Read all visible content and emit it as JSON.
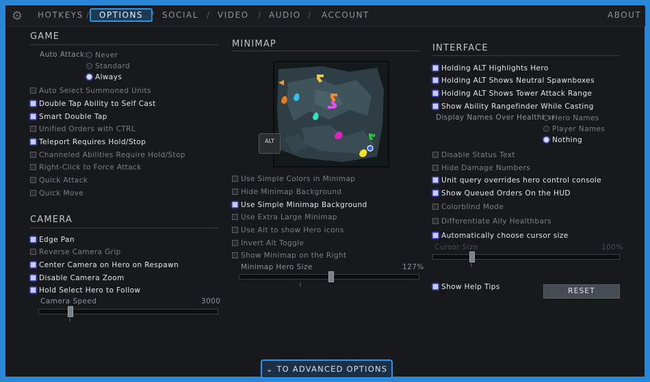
{
  "nav": {
    "tabs": [
      "HOTKEYS",
      "OPTIONS",
      "SOCIAL",
      "VIDEO",
      "AUDIO",
      "ACCOUNT"
    ],
    "active_tab": "OPTIONS",
    "about": "ABOUT",
    "separator": "/"
  },
  "game": {
    "title": "GAME",
    "auto_attack_label": "Auto Attack:",
    "auto_attack_options": [
      "Never",
      "Standard",
      "Always"
    ],
    "auto_attack_selected": "Always",
    "options": [
      {
        "label": "Auto Select Summoned Units",
        "checked": false
      },
      {
        "label": "Double Tap Ability to Self Cast",
        "checked": true
      },
      {
        "label": "Smart Double Tap",
        "checked": true
      },
      {
        "label": "Unified Orders with CTRL",
        "checked": false
      },
      {
        "label": "Teleport Requires Hold/Stop",
        "checked": true
      },
      {
        "label": "Channeled Abilities Require Hold/Stop",
        "checked": false
      },
      {
        "label": "Right-Click to Force Attack",
        "checked": false
      },
      {
        "label": "Quick Attack",
        "checked": false
      },
      {
        "label": "Quick Move",
        "checked": false
      }
    ]
  },
  "camera": {
    "title": "CAMERA",
    "options": [
      {
        "label": "Edge Pan",
        "checked": true
      },
      {
        "label": "Reverse Camera Grip",
        "checked": false
      },
      {
        "label": "Center Camera on Hero on Respawn",
        "checked": true
      },
      {
        "label": "Disable Camera Zoom",
        "checked": true
      },
      {
        "label": "Hold Select Hero to Follow",
        "checked": true
      }
    ],
    "speed_label": "Camera Speed",
    "speed_value": "3000",
    "speed_fraction": 0.18
  },
  "minimap": {
    "title": "MINIMAP",
    "alt_key": "ALT",
    "options": [
      {
        "label": "Use Simple Colors in Minimap",
        "checked": false
      },
      {
        "label": "Hide Minimap Background",
        "checked": false
      },
      {
        "label": "Use Simple Minimap Background",
        "checked": true
      },
      {
        "label": "Use Extra Large Minimap",
        "checked": false
      },
      {
        "label": "Use Alt to show Hero icons",
        "checked": false
      },
      {
        "label": "Invert Alt Toggle",
        "checked": false
      },
      {
        "label": "Show Minimap on the Right",
        "checked": false
      }
    ],
    "hero_size_label": "Minimap Hero Size",
    "hero_size_value": "127%",
    "hero_size_fraction": 0.51
  },
  "interface": {
    "title": "INTERFACE",
    "options_top": [
      {
        "label": "Holding ALT Highlights Hero",
        "checked": true
      },
      {
        "label": "Holding ALT Shows Neutral Spawnboxes",
        "checked": true
      },
      {
        "label": "Holding ALT Shows Tower Attack Range",
        "checked": true
      },
      {
        "label": "Show Ability Rangefinder While Casting",
        "checked": true
      }
    ],
    "display_names_label": "Display Names Over Healthbar",
    "display_names_options": [
      "Hero Names",
      "Player Names",
      "Nothing"
    ],
    "display_names_selected": "Nothing",
    "options_bottom": [
      {
        "label": "Disable Status Text",
        "checked": false
      },
      {
        "label": "Hide Damage Numbers",
        "checked": false
      },
      {
        "label": "Unit query overrides hero control console",
        "checked": true
      },
      {
        "label": "Show Queued Orders On the HUD",
        "checked": true
      },
      {
        "label": "Colorblind Mode",
        "checked": false
      },
      {
        "label": "Differentiate Ally Healthbars",
        "checked": false
      },
      {
        "label": "Automatically choose cursor size",
        "checked": true
      }
    ],
    "cursor_size_label": "Cursor Size",
    "cursor_size_value": "100%",
    "cursor_size_fraction": 0.21,
    "help_tips": {
      "label": "Show Help Tips",
      "checked": true
    },
    "reset_label": "RESET"
  },
  "footer": {
    "advanced_label": "TO ADVANCED OPTIONS"
  },
  "colors": {
    "accent": "#2a95ea",
    "checked": "#c8ccff",
    "background": "#17191c"
  }
}
